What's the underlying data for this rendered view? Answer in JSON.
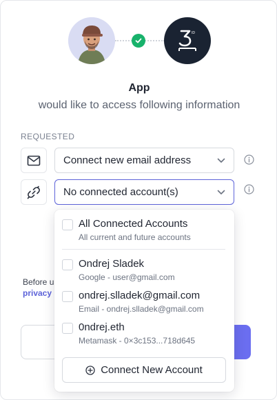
{
  "header": {
    "user_avatar_icon": "user-avatar",
    "check_icon": "checkmark-icon",
    "app_logo_icon": "3id-logo",
    "app_logo_text": "3"
  },
  "app_name": "App",
  "subtitle": "would like to access following information",
  "requested": {
    "label": "REQUESTED",
    "items": [
      {
        "icon": "mail-icon",
        "value": "Connect new email address"
      },
      {
        "icon": "link-icon",
        "value": "No connected account(s)"
      }
    ]
  },
  "dropdown": {
    "all": {
      "title": "All Connected Accounts",
      "sub": "All current and future accounts"
    },
    "accounts": [
      {
        "title": "Ondrej Sladek",
        "sub": "Google - user@gmail.com"
      },
      {
        "title": "ondrej.slladek@gmail.com",
        "sub": "Email - ondrej.slladek@gmail.com"
      },
      {
        "title": "0ndrej.eth",
        "sub": "Metamask - 0×3c153...718d645"
      }
    ],
    "connect_label": "Connect New Account"
  },
  "footer": {
    "before_text": "Before u",
    "privacy_text": "privacy"
  },
  "colors": {
    "accent": "#5d63d9",
    "success": "#18b26b",
    "logo_bg": "#1a2332"
  }
}
